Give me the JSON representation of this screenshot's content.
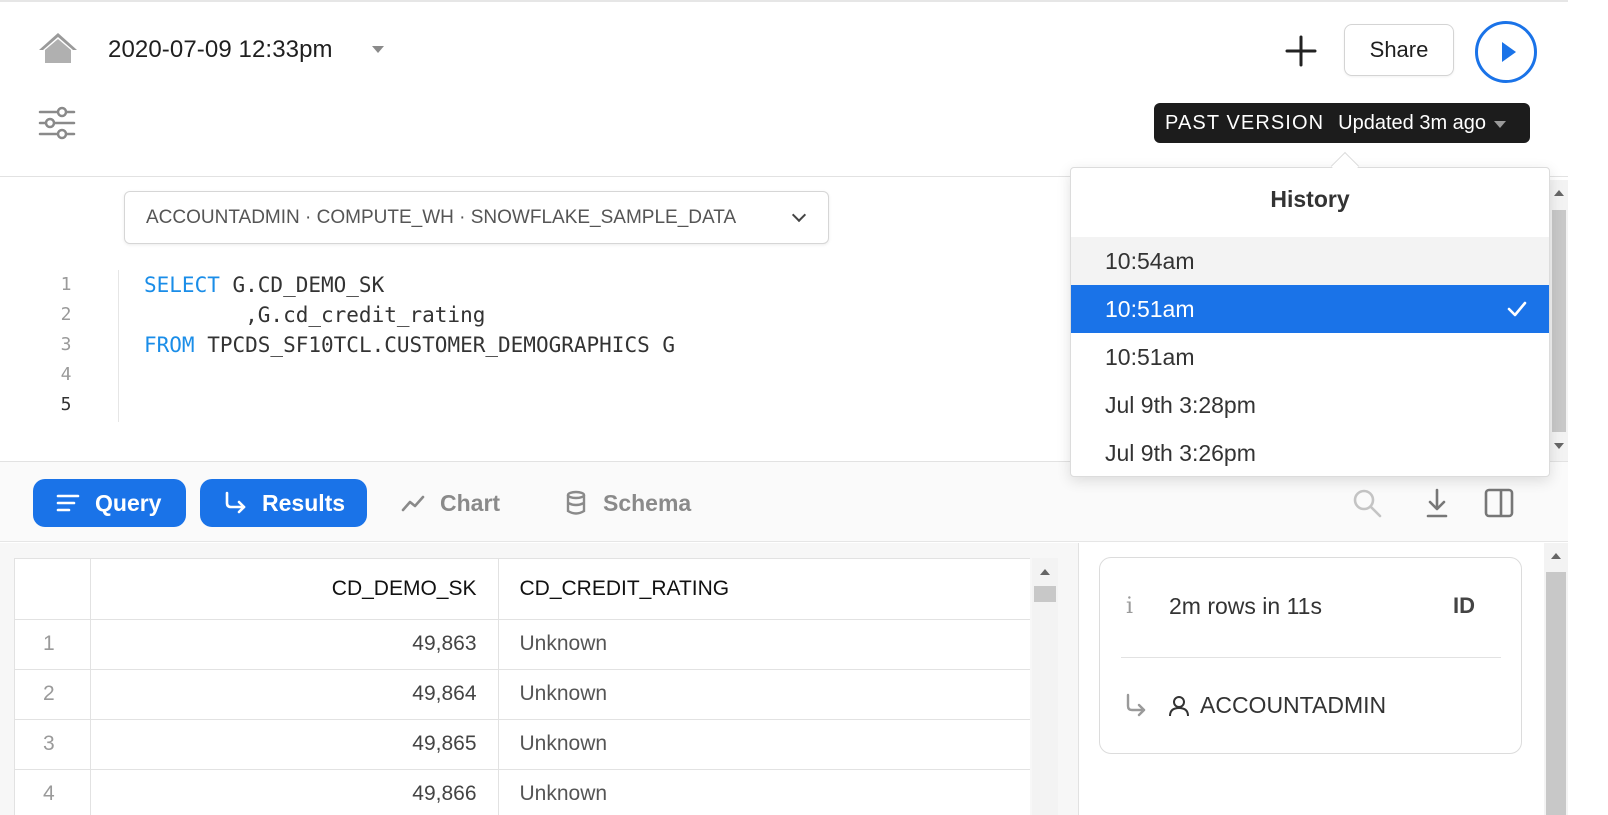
{
  "header": {
    "title": "2020-07-09 12:33pm",
    "share_label": "Share",
    "version_label": "PAST VERSION",
    "version_status": "Updated 3m ago"
  },
  "editor": {
    "context": "ACCOUNTADMIN · COMPUTE_WH · SNOWFLAKE_SAMPLE_DATA",
    "line_numbers": [
      "1",
      "2",
      "3",
      "4",
      "5"
    ],
    "code": {
      "line1_kw": "SELECT",
      "line1_rest": " G.CD_DEMO_SK",
      "line2": "        ,G.cd_credit_rating",
      "line3_kw": "FROM",
      "line3_rest": " TPCDS_SF10TCL.CUSTOMER_DEMOGRAPHICS G"
    }
  },
  "history": {
    "title": "History",
    "items": [
      "10:54am",
      "10:51am",
      "10:51am",
      "Jul 9th 3:28pm",
      "Jul 9th 3:26pm"
    ]
  },
  "tabs": {
    "query": "Query",
    "results": "Results",
    "chart": "Chart",
    "schema": "Schema"
  },
  "results_table": {
    "columns": [
      "CD_DEMO_SK",
      "CD_CREDIT_RATING"
    ],
    "rows": [
      {
        "idx": "1",
        "sk": "49,863",
        "rating": "Unknown"
      },
      {
        "idx": "2",
        "sk": "49,864",
        "rating": "Unknown"
      },
      {
        "idx": "3",
        "sk": "49,865",
        "rating": "Unknown"
      },
      {
        "idx": "4",
        "sk": "49,866",
        "rating": "Unknown"
      }
    ]
  },
  "details": {
    "rows_summary": "2m rows in 11s",
    "id_label": "ID",
    "role": "ACCOUNTADMIN"
  },
  "colors": {
    "accent": "#1a73e8",
    "keyword": "#1a8de8",
    "pill_bg": "#1c1c1c"
  }
}
